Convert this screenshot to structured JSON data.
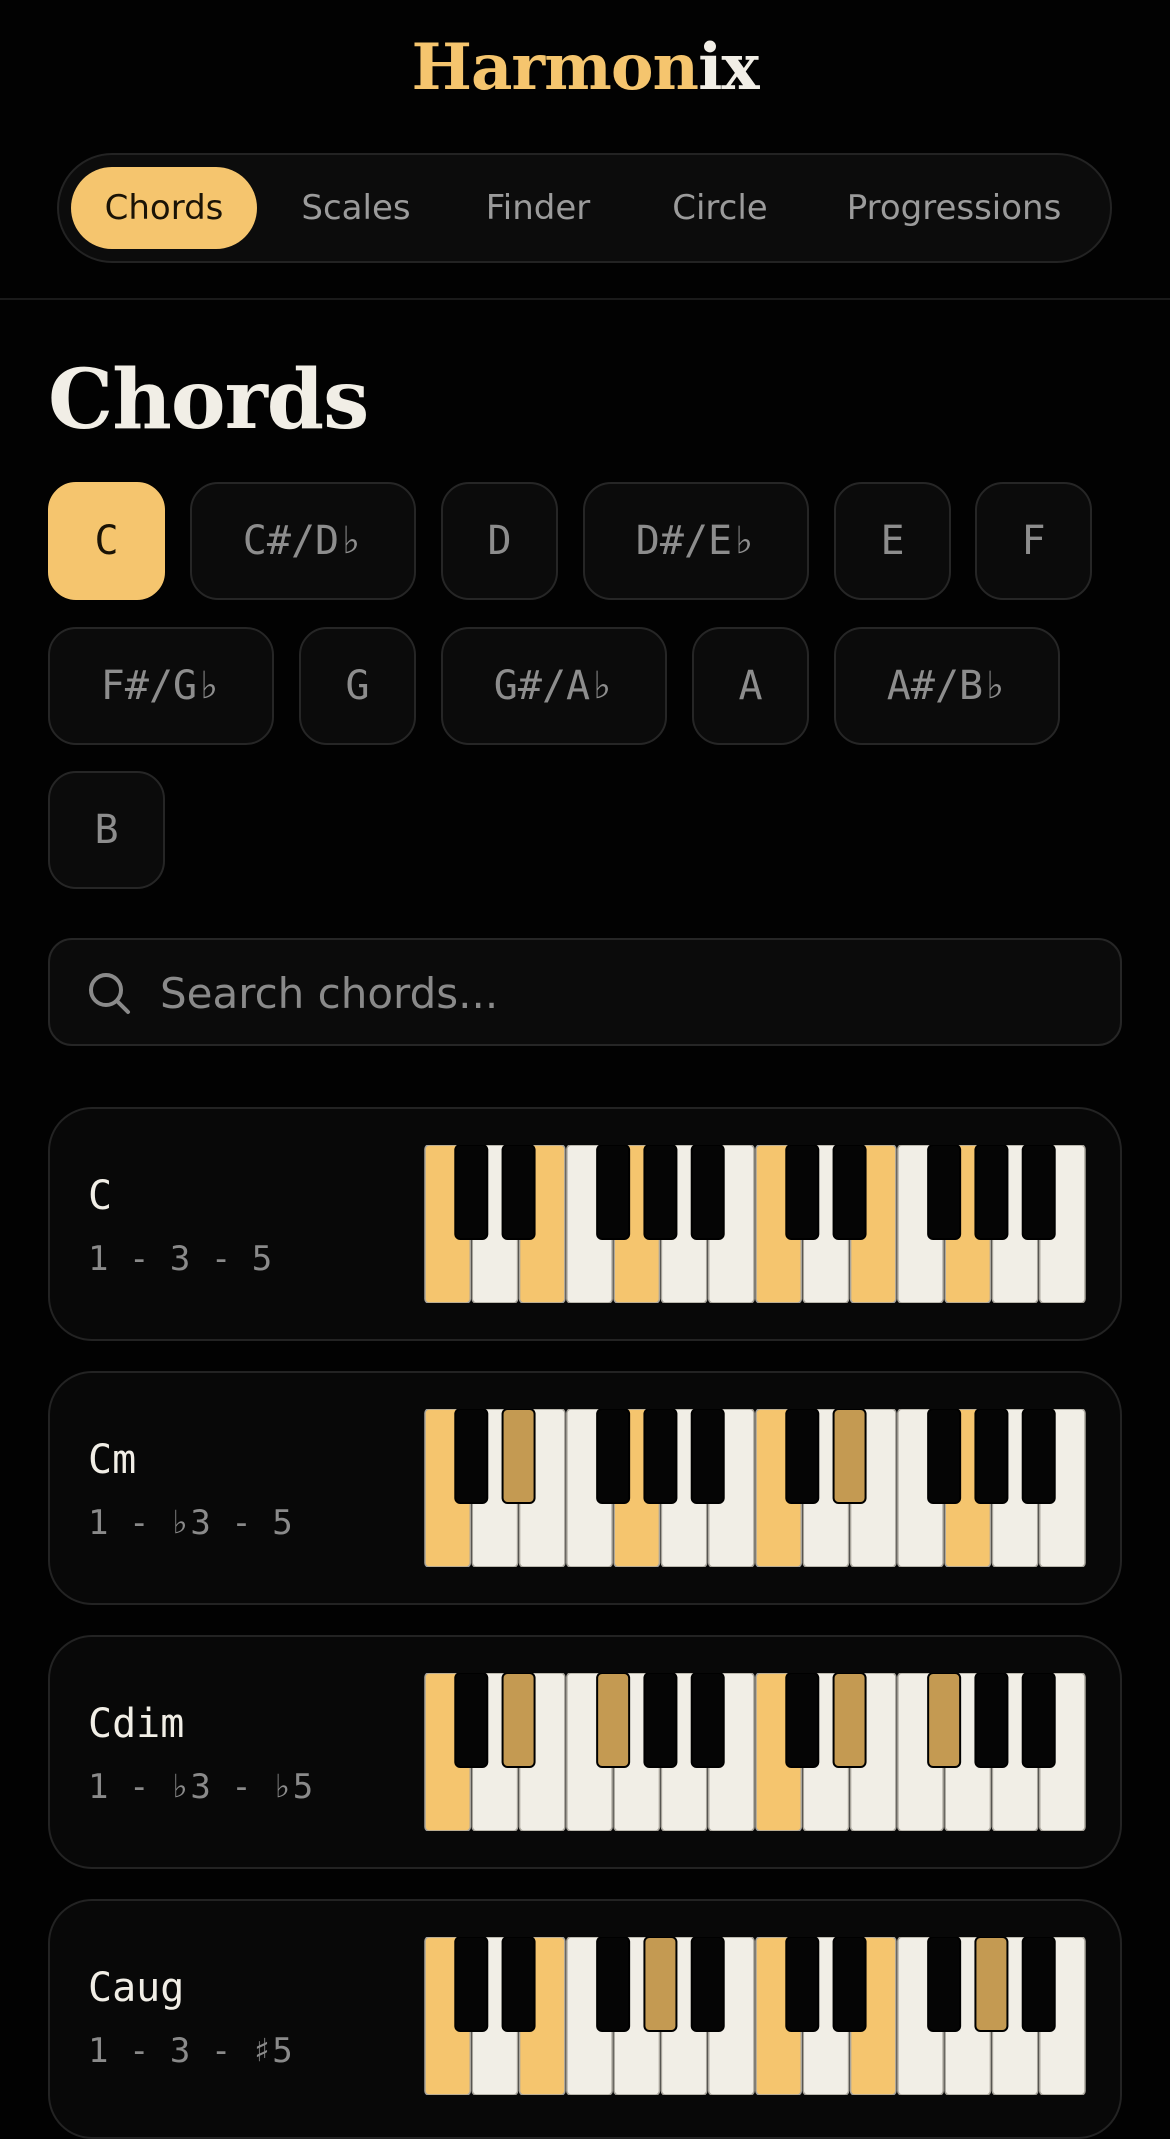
{
  "app": {
    "logo_part1": "Harmon",
    "logo_part2": "ix"
  },
  "tabs": [
    {
      "label": "Chords",
      "active": true
    },
    {
      "label": "Scales",
      "active": false
    },
    {
      "label": "Finder",
      "active": false
    },
    {
      "label": "Circle",
      "active": false
    },
    {
      "label": "Progressions",
      "active": false
    }
  ],
  "page": {
    "title": "Chords"
  },
  "keys": [
    {
      "label": "C",
      "active": true
    },
    {
      "label": "C#/D♭",
      "active": false
    },
    {
      "label": "D",
      "active": false
    },
    {
      "label": "D#/E♭",
      "active": false
    },
    {
      "label": "E",
      "active": false
    },
    {
      "label": "F",
      "active": false
    },
    {
      "label": "F#/G♭",
      "active": false
    },
    {
      "label": "G",
      "active": false
    },
    {
      "label": "G#/A♭",
      "active": false
    },
    {
      "label": "A",
      "active": false
    },
    {
      "label": "A#/B♭",
      "active": false
    },
    {
      "label": "B",
      "active": false
    }
  ],
  "search": {
    "placeholder": "Search chords...",
    "value": "",
    "icon": "search-icon"
  },
  "chords": [
    {
      "name": "C",
      "formula": "1 - 3 - 5",
      "white_highlight": [
        0,
        2,
        4,
        7,
        9,
        11
      ],
      "black_highlight": []
    },
    {
      "name": "Cm",
      "formula": "1 - ♭3 - 5",
      "white_highlight": [
        0,
        4,
        7,
        11
      ],
      "black_highlight": [
        1,
        6
      ]
    },
    {
      "name": "Cdim",
      "formula": "1 - ♭3 - ♭5",
      "white_highlight": [
        0,
        7
      ],
      "black_highlight": [
        1,
        2,
        6,
        7
      ]
    },
    {
      "name": "Caug",
      "formula": "1 - 3 - ♯5",
      "white_highlight": [
        0,
        2,
        7,
        9
      ],
      "black_highlight": [
        3,
        8
      ]
    }
  ],
  "colors": {
    "accent": "#f5c56e",
    "accent_black_key": "#c49a52",
    "background": "#020202",
    "card_background": "#080808",
    "white_key": "#f1eee6",
    "black_key": "#050505"
  }
}
